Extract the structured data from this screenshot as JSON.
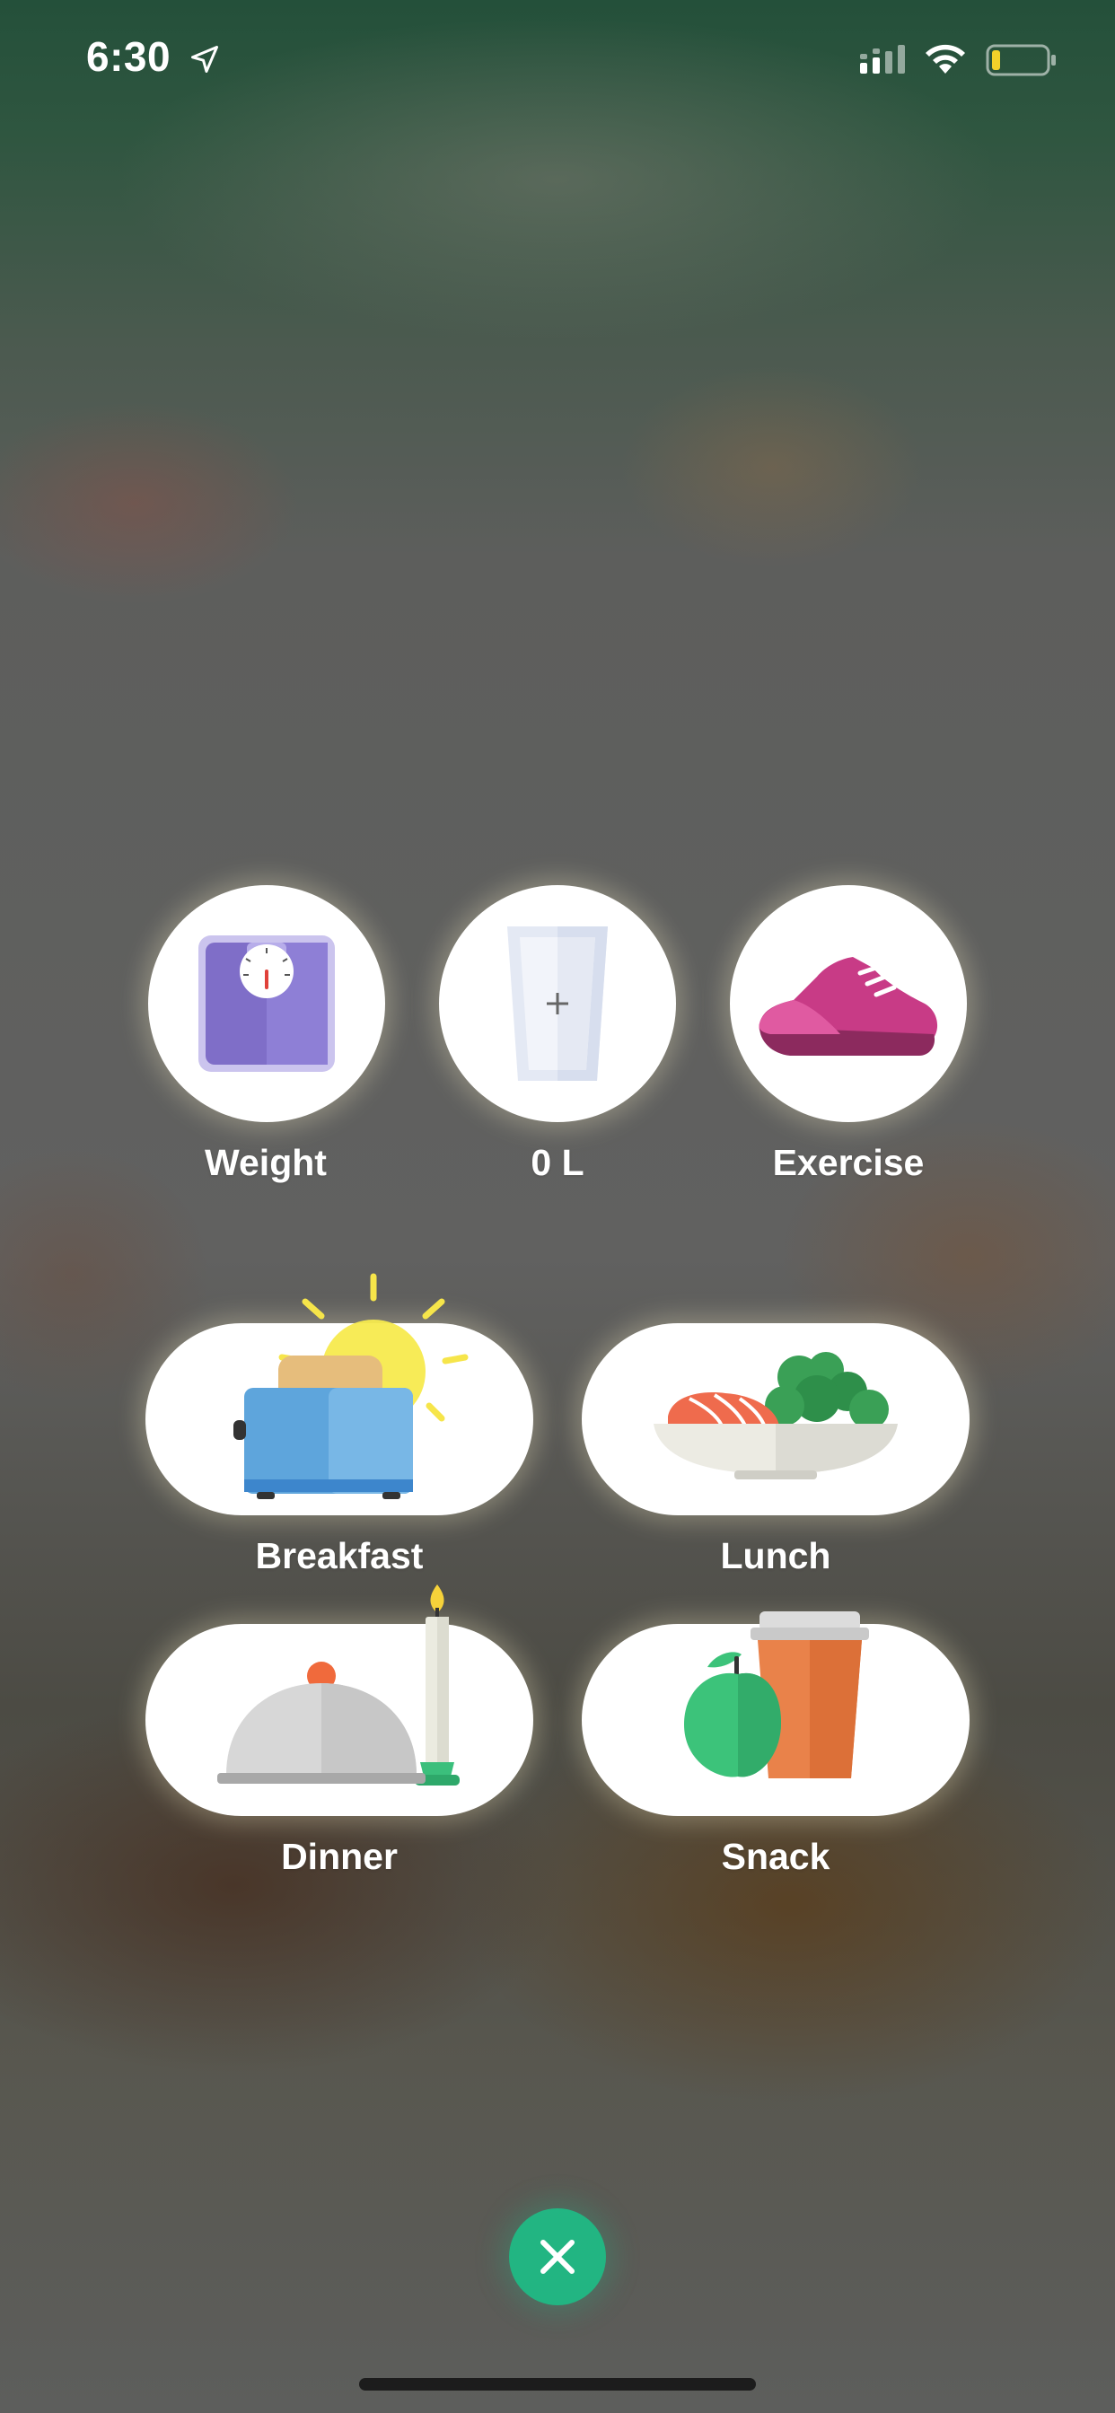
{
  "status_bar": {
    "time": "6:30"
  },
  "quick_actions": [
    {
      "label": "Weight",
      "icon": "scale-icon"
    },
    {
      "label": "0 L",
      "icon": "water-glass-icon"
    },
    {
      "label": "Exercise",
      "icon": "sneaker-icon"
    }
  ],
  "meals": [
    {
      "label": "Breakfast",
      "icon": "toaster-sun-icon"
    },
    {
      "label": "Lunch",
      "icon": "salmon-salad-bowl-icon"
    },
    {
      "label": "Dinner",
      "icon": "cloche-candle-icon"
    },
    {
      "label": "Snack",
      "icon": "apple-coffee-cup-icon"
    }
  ],
  "colors": {
    "accent": "#22b582",
    "scale_purple": "#7f6ec8",
    "shoe_pink": "#c83b86",
    "toaster_blue": "#5aa0d8",
    "salmon": "#ef6b4d",
    "apple_green": "#3cc37a",
    "cup_orange": "#e9824a"
  }
}
